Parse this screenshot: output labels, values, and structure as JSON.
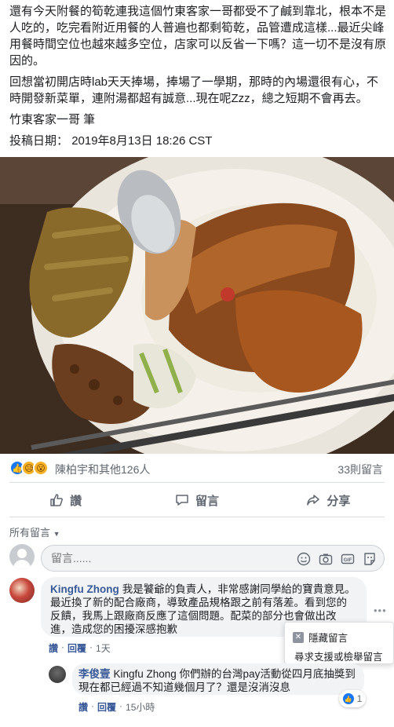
{
  "post": {
    "paragraph1": "還有今天附餐的筍乾連我這個竹東客家一哥都受不了鹹到靠北，根本不是人吃的，吃完看附近用餐的人普遍也都剩筍乾，品管遭成這樣...最近尖峰用餐時間空位也越來越多空位，店家可以反省一下嗎？這一切不是沒有原因的。",
    "paragraph2": "回想當初開店時lab天天捧場，捧場了一學期，那時的內場還很有心，不時開發新菜單，連附湯都超有誠意...現在呢Zzz，總之短期不會再去。",
    "signature": "竹東客家一哥 筆",
    "date_label": "投稿日期：",
    "date_value": "2019年8月13日 18:26 CST"
  },
  "reactions": {
    "names": "陳柏宇和其他126人",
    "comment_count": "33則留言",
    "icons": [
      "like-icon",
      "sad-icon",
      "wow-icon"
    ]
  },
  "actions": {
    "like": "讚",
    "comment": "留言",
    "share": "分享"
  },
  "comments_header": "所有留言",
  "composer": {
    "placeholder": "留言......"
  },
  "comments": [
    {
      "author": "Kingfu Zhong",
      "text": "我是饕爺的負責人，非常感謝同學給的寶貴意見。最近換了新的配合廠商，導致產品規格跟之前有落差。看到您的反饋，我馬上跟廠商反應了這個問題。配菜的部分也會做出改進，造成您的困擾深感抱歉",
      "like": "讚",
      "reply": "回覆",
      "time": "1天"
    },
    {
      "author": "李俊壹",
      "text": "Kingfu Zhong 你們辦的台灣pay活動從四月底抽獎到現在都已經過不知道幾個月了？還是沒消沒息",
      "like": "讚",
      "reply": "回覆",
      "time": "15小時",
      "like_count": "1"
    }
  ],
  "context_menu": {
    "hide": "隱藏留言",
    "support": "尋求支援或檢舉留言"
  },
  "colors": {
    "link": "#385898",
    "like_blue": "#1877f2",
    "muted": "#606770"
  }
}
